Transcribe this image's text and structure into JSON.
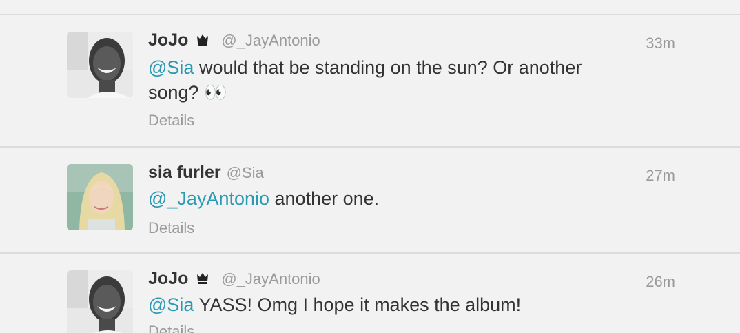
{
  "tweets": [
    {
      "fullname": "JoJo",
      "handle": "@_JayAntonio",
      "time": "33m",
      "mention": "@Sia",
      "text_line1": " would that be standing on the sun? Or another",
      "text_line2": "song? 👀",
      "details_label": "Details"
    },
    {
      "fullname": "sia furler",
      "handle": "@Sia",
      "time": "27m",
      "mention": "@_JayAntonio",
      "text_line1": " another one.",
      "details_label": "Details"
    },
    {
      "fullname": "JoJo",
      "handle": "@_JayAntonio",
      "time": "26m",
      "mention": "@Sia",
      "text_line1": " YASS! Omg I hope it makes the album!",
      "details_label": "Details"
    }
  ],
  "icons": {
    "crown": "crown-icon"
  },
  "colors": {
    "mention": "#2a9ab3",
    "meta": "#9a9a9a",
    "text": "#333333",
    "background": "#f2f2f2"
  }
}
